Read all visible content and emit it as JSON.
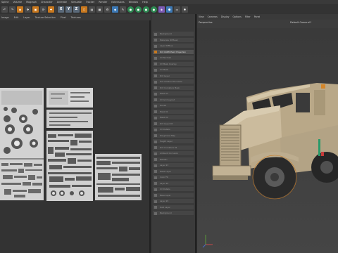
{
  "menubar": [
    "Spline",
    "Volume",
    "Mograph",
    "Character",
    "Animate",
    "Simulate",
    "Tracker",
    "Render",
    "Extensions",
    "Window",
    "Help"
  ],
  "toolbar": {
    "axis_x": "X",
    "axis_y": "Y",
    "axis_z": "Z"
  },
  "uv_menu": [
    "Image",
    "Edit",
    "Layer",
    "Texture Selection",
    "Pixel",
    "Textures"
  ],
  "layers": [
    {
      "label": "Background"
    },
    {
      "label": "Materials (Diffuse)"
    },
    {
      "label": "Layer Diffuse"
    },
    {
      "label": "Dirt GVRM Paint Projection"
    },
    {
      "label": "UV Normals"
    },
    {
      "label": "UV Mask Overlay"
    },
    {
      "label": "UV Mask"
    },
    {
      "label": "Dirt Layer"
    },
    {
      "label": "Dirt Ambient Occlusion"
    },
    {
      "label": "Dirt Curvature Mask"
    },
    {
      "label": "Mask UV"
    },
    {
      "label": "UV Grid Layout"
    },
    {
      "label": "Decals"
    },
    {
      "label": "Mask 01"
    },
    {
      "label": "Mask 02"
    },
    {
      "label": "Dirt Layer 02"
    },
    {
      "label": "UV Details"
    },
    {
      "label": "Roughness Map"
    },
    {
      "label": "Height Layer"
    },
    {
      "label": "Dirt Curvature 02"
    },
    {
      "label": "Ambient Occlusion"
    },
    {
      "label": "Metallic"
    },
    {
      "label": "Layer 23"
    },
    {
      "label": "Mask Layer"
    },
    {
      "label": "Color Fill"
    },
    {
      "label": "Layer 26"
    },
    {
      "label": "UV Details"
    },
    {
      "label": "Base Layer"
    },
    {
      "label": "Layer 29"
    },
    {
      "label": "Rust Layer"
    },
    {
      "label": "Background"
    }
  ],
  "viewport": {
    "menu": [
      "View",
      "Cameras",
      "Display",
      "Options",
      "Filter",
      "Panel"
    ],
    "label": "Perspective",
    "camera": "Default Camera**"
  },
  "colors": {
    "accent": "#c8781e",
    "truck": "#c9b89a"
  }
}
